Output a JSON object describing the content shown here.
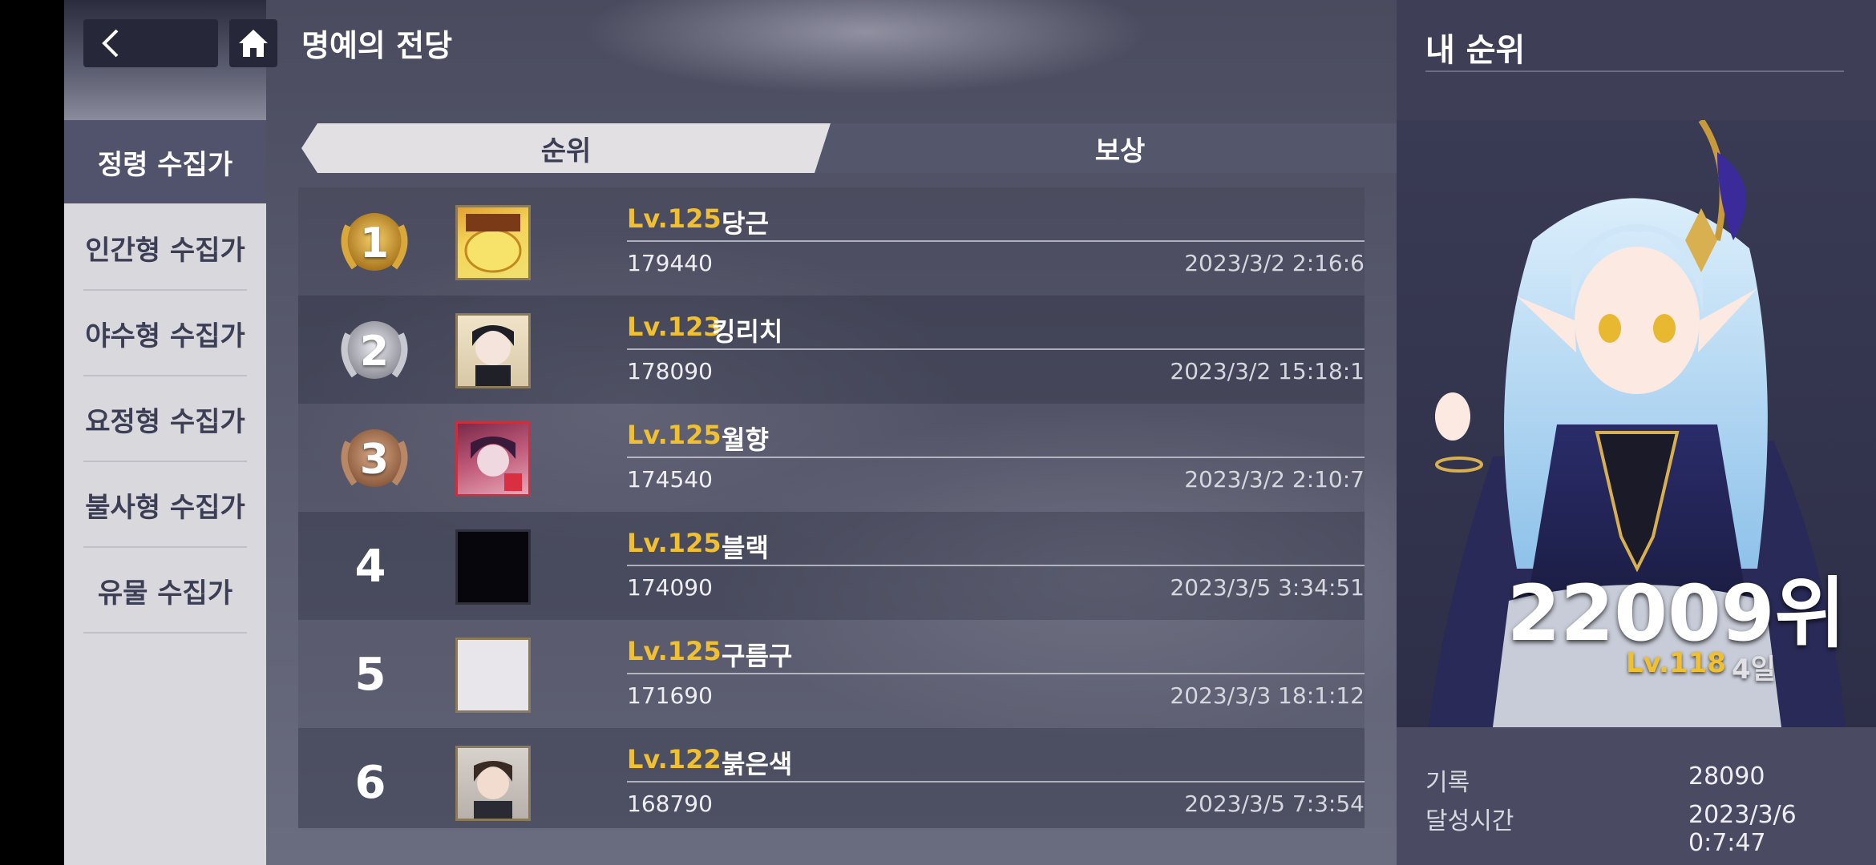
{
  "header": {
    "title": "명예의 전당"
  },
  "sidebar": {
    "items": [
      {
        "label": "정령 수집가",
        "active": true
      },
      {
        "label": "인간형 수집가",
        "active": false
      },
      {
        "label": "야수형 수집가",
        "active": false
      },
      {
        "label": "요정형 수집가",
        "active": false
      },
      {
        "label": "불사형 수집가",
        "active": false
      },
      {
        "label": "유물 수집가",
        "active": false
      }
    ]
  },
  "tabs": [
    {
      "label": "순위",
      "selected": true
    },
    {
      "label": "보상",
      "selected": false
    }
  ],
  "ranking": [
    {
      "rank": "1",
      "level": "Lv.125",
      "name": "당근",
      "score": "179440",
      "date": "2023/3/2 2:16:6",
      "medal": "gold"
    },
    {
      "rank": "2",
      "level": "Lv.123",
      "name": "킹리치",
      "score": "178090",
      "date": "2023/3/2 15:18:1",
      "medal": "silver"
    },
    {
      "rank": "3",
      "level": "Lv.125",
      "name": "월향",
      "score": "174540",
      "date": "2023/3/2 2:10:7",
      "medal": "bronze"
    },
    {
      "rank": "4",
      "level": "Lv.125",
      "name": "블랙",
      "score": "174090",
      "date": "2023/3/5 3:34:51",
      "medal": ""
    },
    {
      "rank": "5",
      "level": "Lv.125",
      "name": "구름구",
      "score": "171690",
      "date": "2023/3/3 18:1:12",
      "medal": ""
    },
    {
      "rank": "6",
      "level": "Lv.122",
      "name": "붉은색",
      "score": "168790",
      "date": "2023/3/5 7:3:54",
      "medal": ""
    }
  ],
  "my_rank": {
    "title": "내 순위",
    "rank": "22009위",
    "level": "Lv.118",
    "days": "4일",
    "record_label": "기록",
    "record_value": "28090",
    "time_label": "달성시간",
    "time_value": "2023/3/6 0:7:47"
  },
  "colors": {
    "accent_gold": "#f0c030",
    "sidebar_active": "#51526b",
    "tab_selected": "#e2e0e2"
  },
  "icons": [
    "back-arrow-icon",
    "home-icon",
    "laurel-medal-icon"
  ]
}
